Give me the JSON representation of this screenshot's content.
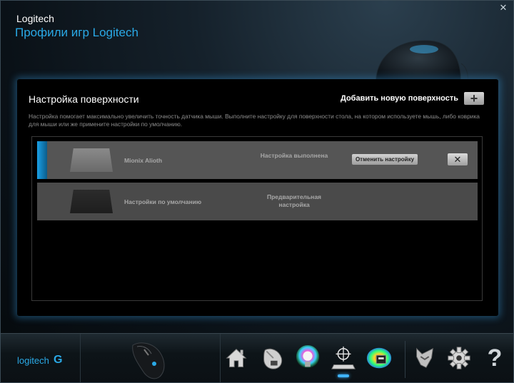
{
  "window": {
    "brand": "Logitech",
    "title": "Профили игр Logitech",
    "close_glyph": "✕"
  },
  "panel": {
    "title": "Настройка поверхности",
    "add_surface_label": "Добавить новую поверхность",
    "add_glyph": "+",
    "description": "Настройка помогает максимально увеличить точность датчика мыши. Выполните настройку для поверхности стола, на котором используете мышь, либо коврика для мыши или же примените настройки по умолчанию."
  },
  "surfaces": [
    {
      "name": "Mionix Alioth",
      "status": "Настройка выполнена",
      "cancel_label": "Отменить настройку",
      "delete_glyph": "✕",
      "active": true
    },
    {
      "name": "Настройки по умолчанию",
      "status": "Предварительная настройка",
      "active": false
    }
  ],
  "taskbar": {
    "logo_text": "logitech",
    "logo_mark": "G",
    "tools": [
      {
        "icon": "home-icon"
      },
      {
        "icon": "mouse-settings-icon"
      },
      {
        "icon": "lighting-icon"
      },
      {
        "icon": "surface-tuning-icon",
        "active": true
      },
      {
        "icon": "heatmap-icon"
      },
      {
        "icon": "arx-control-icon"
      },
      {
        "icon": "gear-icon"
      },
      {
        "icon": "help-icon",
        "glyph": "?"
      }
    ]
  },
  "colors": {
    "accent": "#2aa9e6",
    "active_row": "#555555",
    "row": "#4a4a4a"
  }
}
